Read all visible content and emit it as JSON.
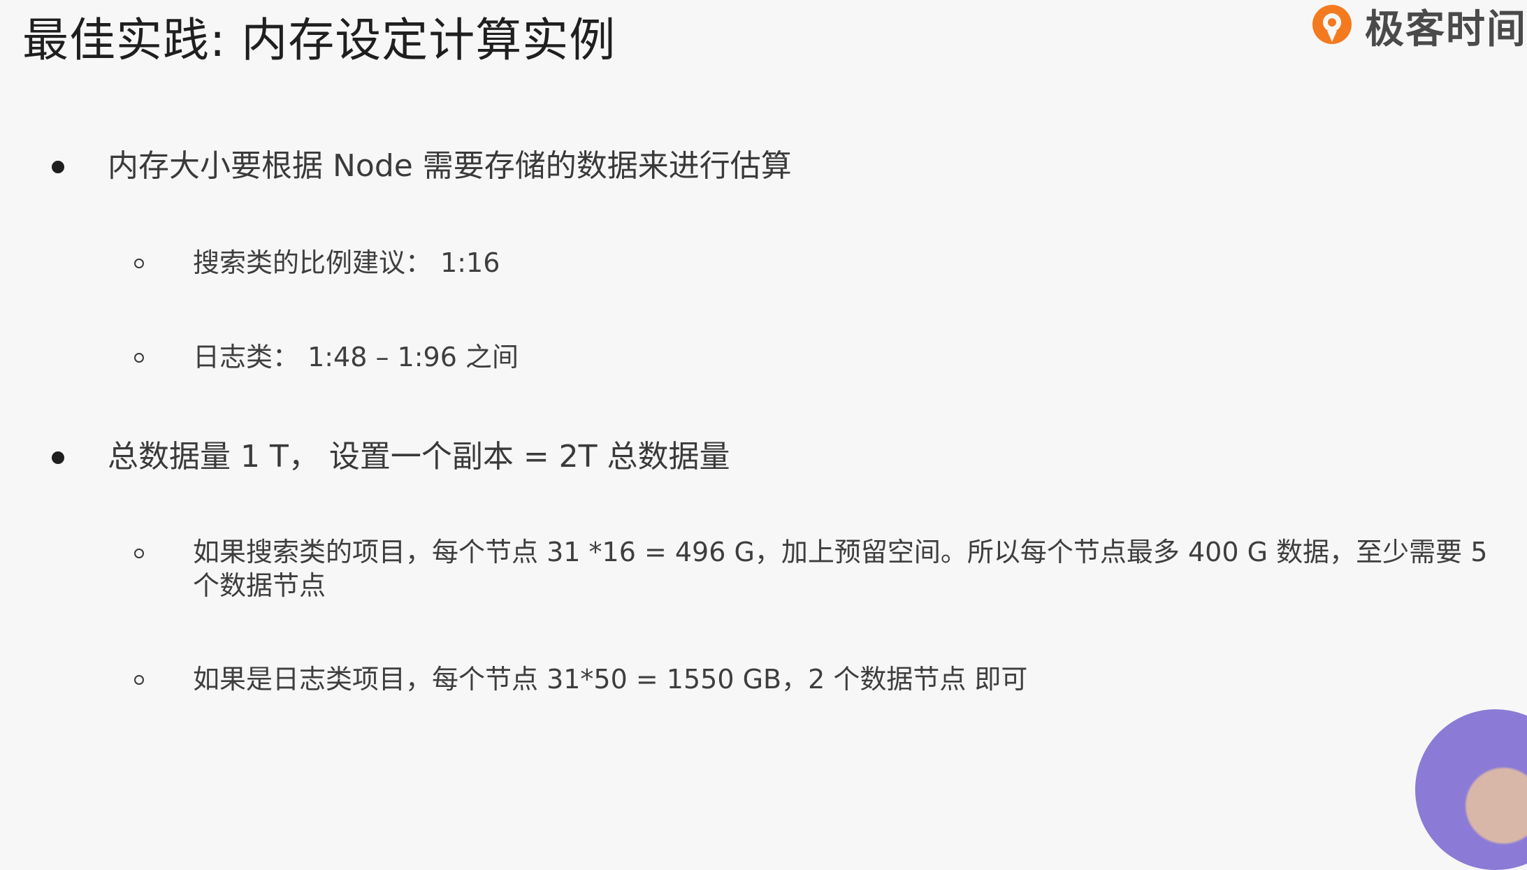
{
  "slide": {
    "title": "最佳实践: 内存设定计算实例"
  },
  "brand": {
    "name": "极客时间",
    "logo_icon": "geektime-logo-icon",
    "accent_color": "#f47a20"
  },
  "bullets": [
    {
      "text": "内存大小要根据 Node 需要存储的数据来进行估算",
      "sub": [
        "搜索类的比例建议： 1:16",
        "日志类： 1:48 – 1:96 之间"
      ]
    },
    {
      "text": "总数据量 1 T，  设置一个副本 = 2T 总数据量",
      "sub": [
        "如果搜索类的项目，每个节点 31 *16 = 496 G，加上预留空间。所以每个节点最多 400 G 数据，至少需要 5 个数据节点",
        "如果是日志类项目，每个节点 31*50 = 1550 GB，2 个数据节点 即可"
      ]
    }
  ]
}
